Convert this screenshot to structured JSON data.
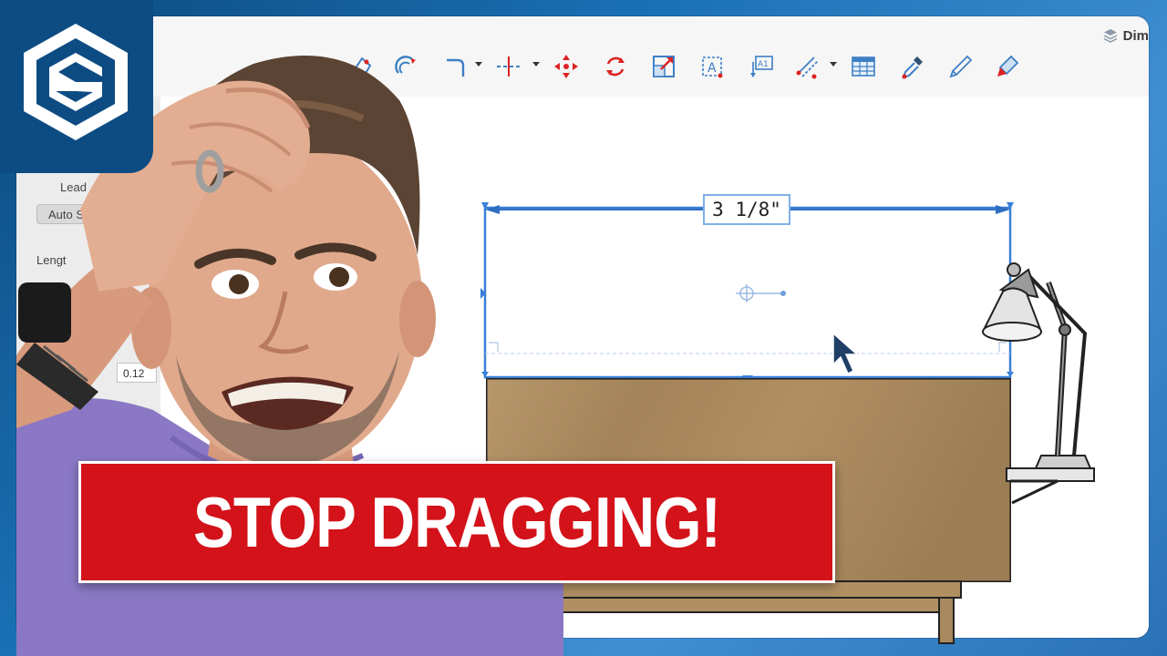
{
  "app": {
    "tab_label": "Dim",
    "tab_icon": "layers-icon"
  },
  "toolbar": {
    "tools": [
      {
        "name": "offset-tool",
        "icon": "offset-icon"
      },
      {
        "name": "arc-tool",
        "icon": "arc-icon"
      },
      {
        "name": "fillet-tool",
        "icon": "fillet-icon",
        "has_dropdown": true
      },
      {
        "name": "split-tool",
        "icon": "split-icon",
        "has_dropdown": true
      },
      {
        "name": "move-tool",
        "icon": "move-icon"
      },
      {
        "name": "rotate-tool",
        "icon": "rotate-icon"
      },
      {
        "name": "scale-tool",
        "icon": "scale-icon"
      },
      {
        "name": "text-tool",
        "icon": "text-icon"
      },
      {
        "name": "label-tool",
        "icon": "label-icon"
      },
      {
        "name": "dimension-tool",
        "icon": "dimension-icon",
        "has_dropdown": true
      },
      {
        "name": "table-tool",
        "icon": "table-icon"
      },
      {
        "name": "sample-tool",
        "icon": "eyedropper-icon"
      },
      {
        "name": "style-tool",
        "icon": "pen-icon"
      },
      {
        "name": "paint-tool",
        "icon": "marker-icon"
      }
    ]
  },
  "left_panel": {
    "leader_label": "Lead",
    "auto_button": "Auto S",
    "length_label": "Lengt",
    "value_field": "0.12"
  },
  "canvas": {
    "dimension_value": "3 1/8\""
  },
  "banner": {
    "text": "STOP DRAGGING!"
  },
  "colors": {
    "brand_blue": "#0d4c83",
    "banner_red": "#d3121a",
    "dimension_blue": "#3a7fd6",
    "wood": "#a98a5e"
  }
}
